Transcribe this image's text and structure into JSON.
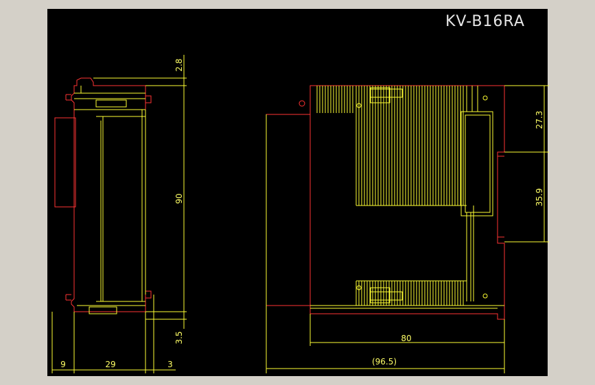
{
  "title": "KV-B16RA",
  "dimensions": {
    "side_top_gap": "2.8",
    "side_height": "90",
    "side_bottom_gap": "3.5",
    "side_width_left": "9",
    "side_width_body": "29",
    "side_width_right": "3",
    "front_upper": "27.3",
    "front_lower": "35.9",
    "front_depth": "80",
    "front_total": "(96.5)"
  },
  "colors": {
    "background_outer": "#d4d0c8",
    "canvas": "#000000",
    "outline": "#ff3333",
    "detail": "#ffff33",
    "text": "#e6e6e6"
  }
}
